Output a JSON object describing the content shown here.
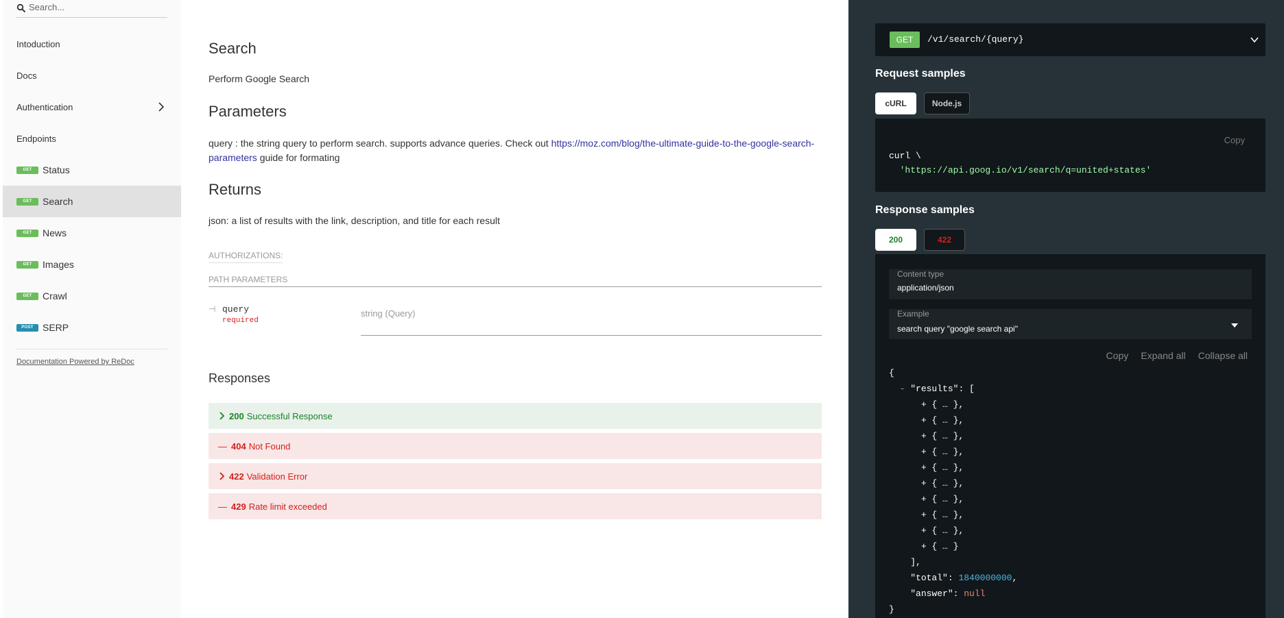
{
  "sidebar": {
    "search_placeholder": "Search...",
    "items": [
      {
        "label": "Intoduction"
      },
      {
        "label": "Docs"
      },
      {
        "label": "Authentication"
      },
      {
        "label": "Endpoints"
      }
    ],
    "operations": [
      {
        "method": "GET",
        "label": "Status"
      },
      {
        "method": "GET",
        "label": "Search"
      },
      {
        "method": "GET",
        "label": "News"
      },
      {
        "method": "GET",
        "label": "Images"
      },
      {
        "method": "GET",
        "label": "Crawl"
      },
      {
        "method": "POST",
        "label": "SERP"
      }
    ],
    "powered_by": "Documentation Powered by ReDoc"
  },
  "main": {
    "title": "Search",
    "description": "Perform Google Search",
    "parameters_heading": "Parameters",
    "parameters_text": "query : the string query to perform search. supports advance queries. Check out ",
    "parameters_link": "https://moz.com/blog/the-ultimate-guide-to-the-google-search-parameters",
    "parameters_suffix": " guide for formating",
    "returns_heading": "Returns",
    "returns_text": "json: a list of results with the link, description, and title for each result",
    "authorizations_label": "AUTHORIZATIONS:",
    "path_parameters_label": "PATH PARAMETERS",
    "param": {
      "tree": "⊣",
      "name": "query",
      "required": "required",
      "type": "string (Query)"
    },
    "responses_heading": "Responses",
    "responses": [
      {
        "code": "200",
        "text": "Successful Response"
      },
      {
        "code": "404",
        "text": "Not Found"
      },
      {
        "code": "422",
        "text": "Validation Error"
      },
      {
        "code": "429",
        "text": "Rate limit exceeded"
      }
    ]
  },
  "panel": {
    "method": "GET",
    "path": "/v1/search/{query}",
    "request_samples_heading": "Request samples",
    "request_tabs": [
      "cURL",
      "Node.js"
    ],
    "copy_label": "Copy",
    "curl_line1": "curl \\",
    "curl_line2": "  'https://api.goog.io/v1/search/q=united+states'",
    "response_samples_heading": "Response samples",
    "response_tabs": [
      "200",
      "422"
    ],
    "content_type_label": "Content type",
    "content_type_value": "application/json",
    "example_label": "Example",
    "example_value": "search query \"google search api\"",
    "actions": [
      "Copy",
      "Expand all",
      "Collapse all"
    ],
    "json": {
      "open": "{",
      "results_prefix": "- ",
      "results_key": "\"results\"",
      "results_open": ": [",
      "item": "+ { … },",
      "item_last": "+ { … }",
      "results_close": "],",
      "total_key": "\"total\"",
      "total_value": "1840000000",
      "answer_key": "\"answer\"",
      "answer_value": "null",
      "close": "}"
    },
    "colors": {
      "get": "#6bbd5b",
      "post": "#248fb2",
      "success": "#1d8127",
      "error": "#d41f1c",
      "panel_bg": "#263238",
      "code_bg": "#11171a",
      "string": "#a0fbaa"
    }
  }
}
